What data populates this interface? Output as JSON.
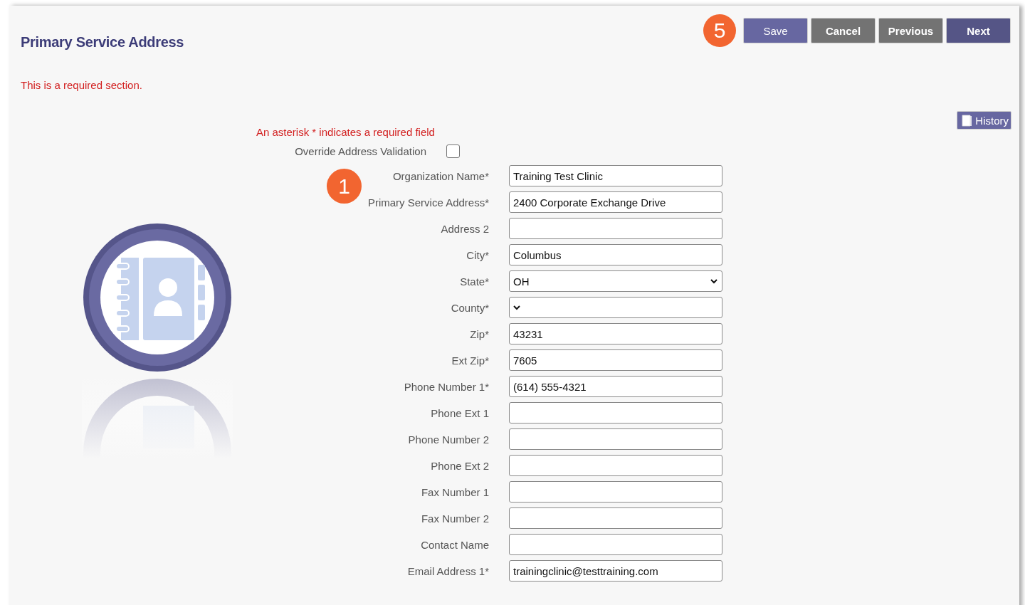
{
  "title": "Primary Service Address",
  "callouts": [
    "5",
    "1"
  ],
  "buttons": [
    {
      "label": "Save",
      "kind": "light"
    },
    {
      "label": "Cancel",
      "kind": "grey"
    },
    {
      "label": "Previous",
      "kind": "grey"
    },
    {
      "label": "Next",
      "kind": "dark"
    }
  ],
  "required_note": "This is a required section.",
  "history_button": "History",
  "asterisk_note": "An asterisk * indicates a required field",
  "override": {
    "label": "Override Address Validation",
    "checked": false
  },
  "fields": [
    {
      "label": "Organization Name*",
      "kind": "text",
      "value": "Training Test Clinic"
    },
    {
      "label": "Primary Service Address*",
      "kind": "text",
      "value": "2400 Corporate Exchange Drive"
    },
    {
      "label": "Address 2",
      "kind": "text"
    },
    {
      "label": "City*",
      "kind": "text",
      "value": "Columbus"
    },
    {
      "label": "State*",
      "kind": "select",
      "value": "OH"
    },
    {
      "label": "County*",
      "kind": "select"
    },
    {
      "label": "Zip*",
      "kind": "text",
      "value": "43231"
    },
    {
      "label": "Ext Zip*",
      "kind": "text",
      "value": "7605"
    },
    {
      "label": "Phone Number 1*",
      "kind": "text",
      "value": "(614) 555-4321"
    },
    {
      "label": "Phone Ext 1",
      "kind": "text"
    },
    {
      "label": "Phone Number 2",
      "kind": "text"
    },
    {
      "label": "Phone Ext 2",
      "kind": "text"
    },
    {
      "label": "Fax Number 1",
      "kind": "text"
    },
    {
      "label": "Fax Number 2",
      "kind": "text"
    },
    {
      "label": "Contact Name",
      "kind": "text"
    },
    {
      "label": "Email Address 1*",
      "kind": "text",
      "value": "trainingclinic@testtraining.com"
    }
  ]
}
